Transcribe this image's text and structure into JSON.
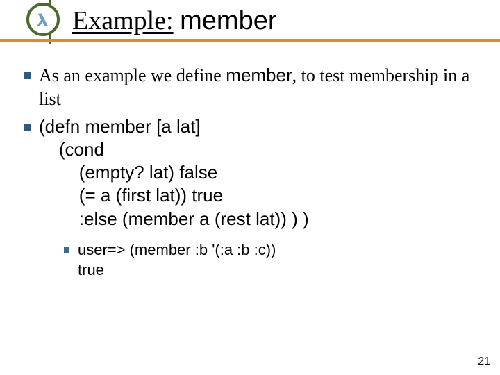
{
  "title": {
    "prefix": "Example:",
    "suffix": "member"
  },
  "bullets": {
    "intro_a": "As an example we define ",
    "intro_b": "member",
    "intro_c": ", to test membership in a list"
  },
  "code": {
    "l1": "(defn member [a lat]",
    "l2": "    (cond",
    "l3": "        (empty? lat) false",
    "l4": "        (= a (first lat)) true",
    "l5": "        :else (member a (rest lat)) ) )"
  },
  "sub": {
    "l1": "user=> (member :b '(:a :b :c))",
    "l2": "true"
  },
  "page_number": "21"
}
